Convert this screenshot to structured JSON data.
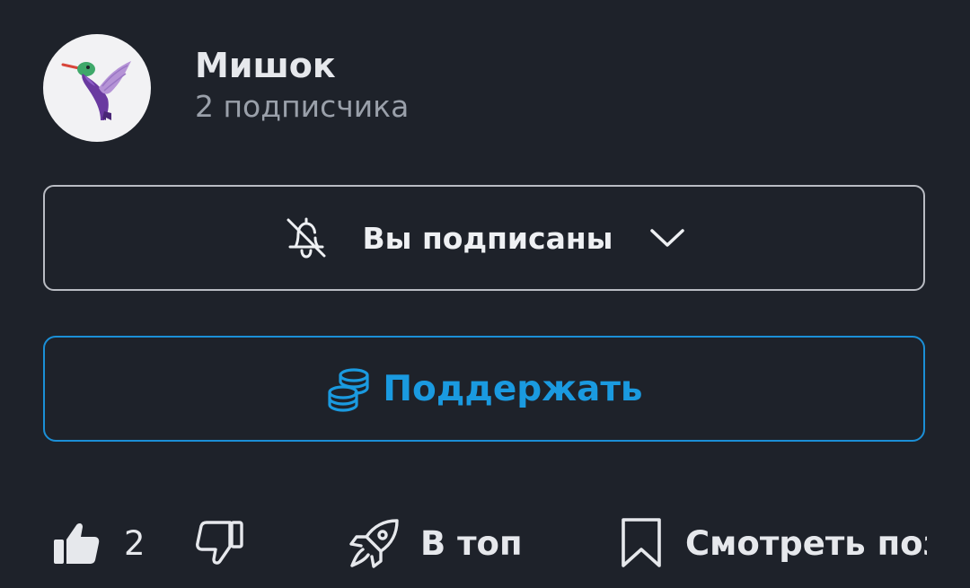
{
  "channel": {
    "name": "Мишок",
    "subscribers": "2 подписчика",
    "avatar_icon": "hummingbird-icon"
  },
  "subscription": {
    "label": "Вы подписаны",
    "bell_icon": "bell-off-icon",
    "dropdown_icon": "chevron-down-icon"
  },
  "support": {
    "label": "Поддержать",
    "icon": "coins-icon",
    "accent_color": "#1a9ae0"
  },
  "actions": {
    "like_count": "2",
    "like_icon": "thumbs-up-icon",
    "dislike_icon": "thumbs-down-icon",
    "top_label": "В топ",
    "top_icon": "rocket-icon",
    "watch_later_label": "Смотреть позже",
    "watch_later_icon": "bookmark-icon"
  },
  "colors": {
    "background": "#1e222a",
    "text": "#e6e8ec",
    "muted": "#9aa0aa",
    "border": "#b9bcc3",
    "accent": "#1b8fd6"
  }
}
